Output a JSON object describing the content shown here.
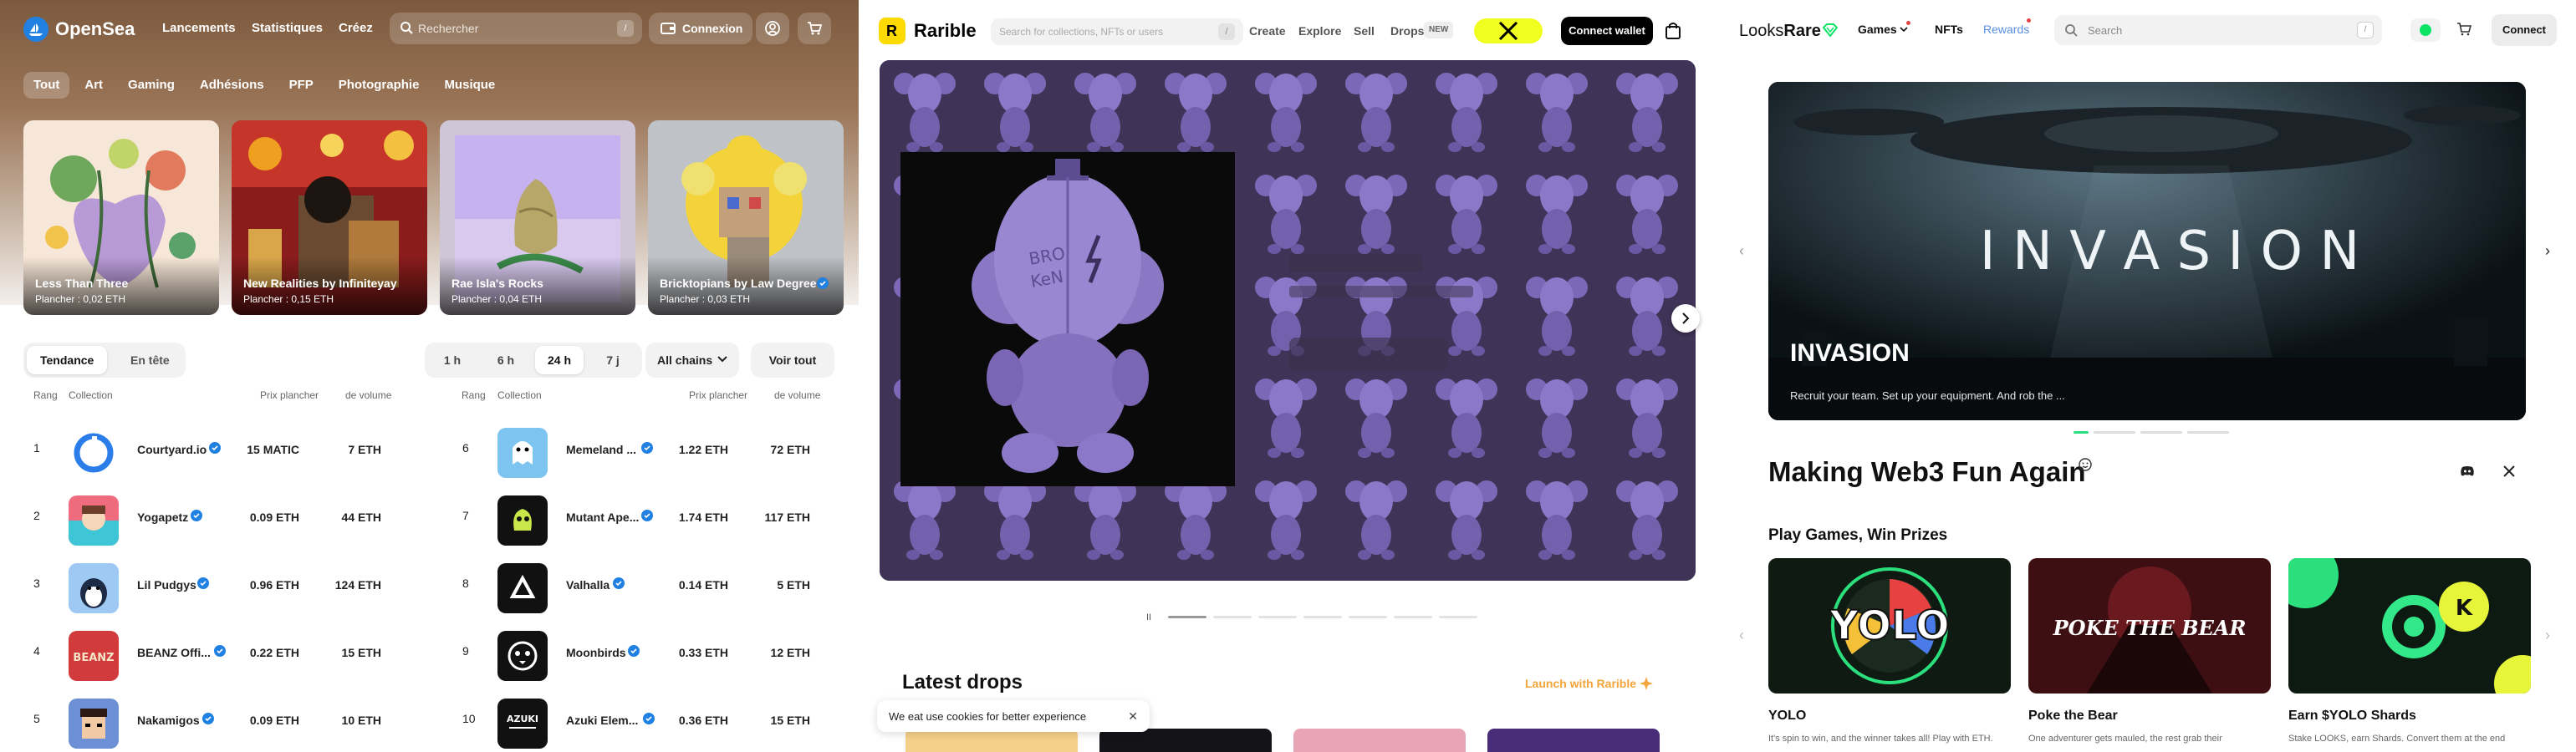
{
  "opensea": {
    "brand": "OpenSea",
    "nav": [
      "Lancements",
      "Statistiques",
      "Créez"
    ],
    "search_placeholder": "Rechercher",
    "search_shortcut": "/",
    "login_label": "Connexion",
    "categories": [
      "Tout",
      "Art",
      "Gaming",
      "Adhésions",
      "PFP",
      "Photographie",
      "Musique"
    ],
    "featured": [
      {
        "name": "Less Than Three",
        "floor": "Plancher : 0,02 ETH"
      },
      {
        "name": "New Realities by Infiniteyay",
        "floor": "Plancher : 0,15 ETH"
      },
      {
        "name": "Rae Isla's Rocks",
        "floor": "Plancher : 0,04 ETH"
      },
      {
        "name": "Bricktopians by Law Degree",
        "floor": "Plancher : 0,03 ETH"
      }
    ],
    "tabs": [
      "Tendance",
      "En tête"
    ],
    "time_filters": [
      "1 h",
      "6 h",
      "24 h",
      "7 j"
    ],
    "chains_label": "All chains",
    "see_all": "Voir tout",
    "table_headers": {
      "rank": "Rang",
      "collection": "Collection",
      "floor": "Prix plancher",
      "volume": "de volume"
    },
    "rows_left": [
      {
        "rank": "1",
        "name": "Courtyard.io",
        "floor": "15 MATIC",
        "volume": "7 ETH"
      },
      {
        "rank": "2",
        "name": "Yogapetz",
        "floor": "0.09 ETH",
        "volume": "44 ETH"
      },
      {
        "rank": "3",
        "name": "Lil Pudgys",
        "floor": "0.96 ETH",
        "volume": "124 ETH"
      },
      {
        "rank": "4",
        "name": "BEANZ Offi...",
        "floor": "0.22 ETH",
        "volume": "15 ETH"
      },
      {
        "rank": "5",
        "name": "Nakamigos",
        "floor": "0.09 ETH",
        "volume": "10 ETH"
      }
    ],
    "rows_right": [
      {
        "rank": "6",
        "name": "Memeland ...",
        "floor": "1.22 ETH",
        "volume": "72 ETH"
      },
      {
        "rank": "7",
        "name": "Mutant Ape...",
        "floor": "1.74 ETH",
        "volume": "117 ETH"
      },
      {
        "rank": "8",
        "name": "Valhalla",
        "floor": "0.14 ETH",
        "volume": "5 ETH"
      },
      {
        "rank": "9",
        "name": "Moonbirds",
        "floor": "0.33 ETH",
        "volume": "12 ETH"
      },
      {
        "rank": "10",
        "name": "Azuki Elem...",
        "floor": "0.36 ETH",
        "volume": "15 ETH"
      }
    ],
    "accent": "#2081e2"
  },
  "rarible": {
    "brand": "Rarible",
    "logo_letter": "R",
    "search_placeholder": "Search for collections, NFTs or users",
    "search_shortcut": "/",
    "nav": [
      "Create",
      "Explore",
      "Sell",
      "Drops"
    ],
    "new_badge": "NEW",
    "connect_label": "Connect wallet",
    "pause_glyph": "II",
    "latest_drops": "Latest drops",
    "launch_label": "Launch with Rarible",
    "cookie_text": "We eat use cookies for better experience",
    "cookie_close": "✕",
    "accent": "#feda03"
  },
  "looksrare": {
    "brand_part1": "Looks",
    "brand_part2": "Rare",
    "nav": [
      "Games",
      "NFTs",
      "Rewards"
    ],
    "search_placeholder": "Search",
    "search_shortcut": "/",
    "connect_label": "Connect",
    "hero_title": "INVASION",
    "hero_big": "I N V A S I O N",
    "hero_desc": "Recruit your team. Set up your equipment. And rob the ...",
    "tagline": "Making Web3 Fun Again",
    "section_title": "Play Games, Win Prizes",
    "games": [
      {
        "name": "YOLO",
        "desc": "It's spin to win, and the winner takes all! Play with ETH."
      },
      {
        "name": "Poke the Bear",
        "desc": "One adventurer gets mauled, the rest grab their"
      },
      {
        "name": "Earn $YOLO Shards",
        "desc": "Stake LOOKS, earn Shards. Convert them at the end"
      }
    ],
    "game_logo_yolo": "YOLO",
    "game_logo_poke": "POKE THE BEAR",
    "accent": "#0ce466"
  }
}
